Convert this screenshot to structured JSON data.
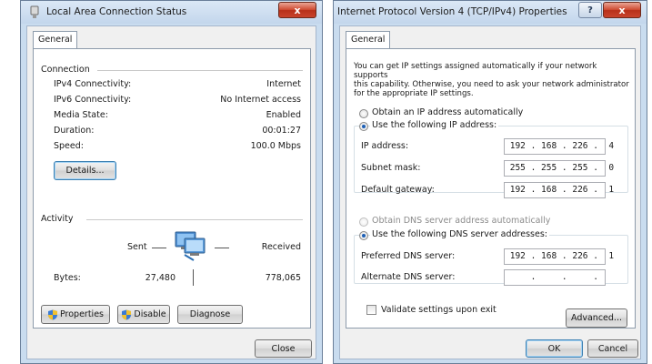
{
  "status_window": {
    "title": "Local Area Connection Status",
    "close_glyph": "x",
    "tab_general": "General",
    "connection": {
      "group_title": "Connection",
      "rows": [
        {
          "label": "IPv4 Connectivity:",
          "value": "Internet"
        },
        {
          "label": "IPv6 Connectivity:",
          "value": "No Internet access"
        },
        {
          "label": "Media State:",
          "value": "Enabled"
        },
        {
          "label": "Duration:",
          "value": "00:01:27"
        },
        {
          "label": "Speed:",
          "value": "100.0 Mbps"
        }
      ],
      "details_button": "Details..."
    },
    "activity": {
      "group_title": "Activity",
      "sent_label": "Sent",
      "received_label": "Received",
      "bytes_label": "Bytes:",
      "bytes_sent": "27,480",
      "bytes_received": "778,065"
    },
    "buttons": {
      "properties": "Properties",
      "disable": "Disable",
      "diagnose": "Diagnose",
      "close": "Close"
    }
  },
  "ipv4_window": {
    "title": "Internet Protocol Version 4 (TCP/IPv4) Properties",
    "help_glyph": "?",
    "close_glyph": "x",
    "tab_general": "General",
    "description": [
      "You can get IP settings assigned automatically if your network supports",
      "this capability. Otherwise, you need to ask your network administrator",
      "for the appropriate IP settings."
    ],
    "radio_auto_ip": "Obtain an IP address automatically",
    "radio_manual_ip": "Use the following IP address:",
    "ip_fields": [
      {
        "label": "IP address:",
        "value": " 192 . 168 . 226 .  4"
      },
      {
        "label": "Subnet mask:",
        "value": " 255 . 255 . 255 .  0"
      },
      {
        "label": "Default gateway:",
        "value": " 192 . 168 . 226 .  1"
      }
    ],
    "radio_auto_dns": "Obtain DNS server address automatically",
    "radio_manual_dns": "Use the following DNS server addresses:",
    "dns_fields": [
      {
        "label": "Preferred DNS server:",
        "value": " 192 . 168 . 226 .  1"
      },
      {
        "label": "Alternate DNS server:",
        "value": "     .     .     .    "
      }
    ],
    "validate_label": "Validate settings upon exit",
    "buttons": {
      "advanced": "Advanced...",
      "ok": "OK",
      "cancel": "Cancel"
    }
  }
}
